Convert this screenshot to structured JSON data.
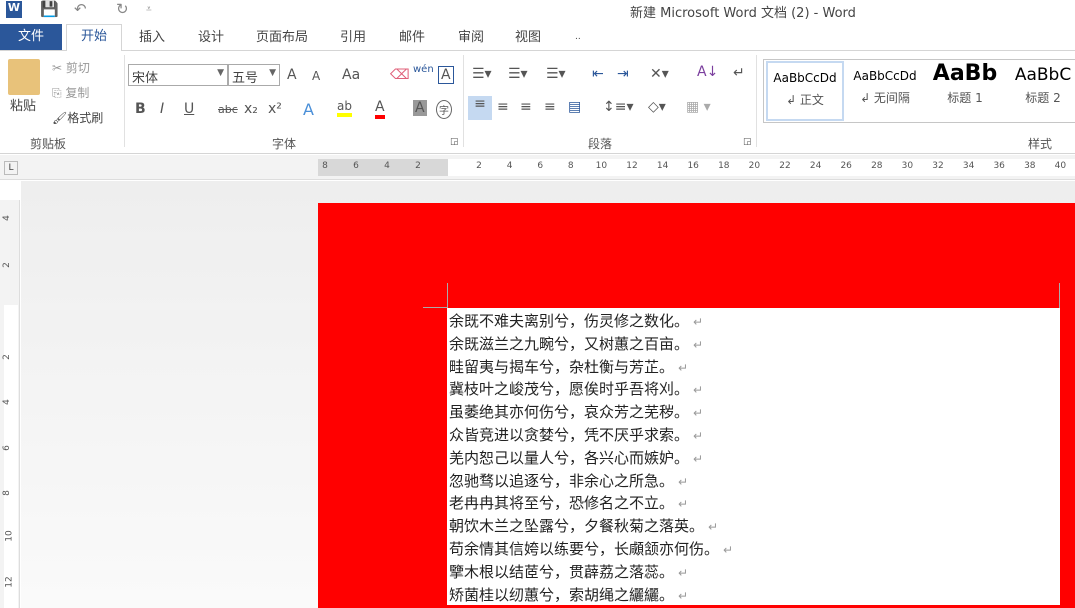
{
  "title": "新建 Microsoft Word 文档 (2) - Word",
  "quick_access": {
    "word": "W",
    "save": "💾",
    "undo": "↶",
    "redo": "↻",
    "customize": "⩡"
  },
  "tabs": {
    "file": "文件",
    "items": [
      "开始",
      "插入",
      "设计",
      "页面布局",
      "引用",
      "邮件",
      "审阅",
      "视图"
    ],
    "more": ".."
  },
  "clipboard": {
    "paste": "粘贴",
    "cut": "剪切",
    "copy": "复制",
    "format_painter": "格式刷",
    "group": "剪贴板"
  },
  "font": {
    "name": "宋体",
    "size": "五号",
    "grow": "A",
    "shrink": "A",
    "case": "Aa",
    "phonetic": "wén",
    "bold": "B",
    "italic": "I",
    "underline": "U",
    "strike": "abc",
    "sub": "x₂",
    "sup": "x²",
    "text_effect": "A",
    "highlight": "ab",
    "font_color": "A",
    "shading": "A",
    "enclose": "字",
    "group": "字体"
  },
  "paragraph": {
    "group": "段落"
  },
  "styles": {
    "group": "样式",
    "items": [
      {
        "preview": "AaBbCcDd",
        "name": "↲ 正文"
      },
      {
        "preview": "AaBbCcDd",
        "name": "↲ 无间隔"
      },
      {
        "preview": "AaBb",
        "name": "标题 1"
      },
      {
        "preview": "AaBbC",
        "name": "标题 2"
      }
    ]
  },
  "ruler": {
    "left": [
      "8",
      "6",
      "4",
      "2"
    ],
    "right": [
      "2",
      "4",
      "6",
      "8",
      "10",
      "12",
      "14",
      "16",
      "18",
      "20",
      "22",
      "24",
      "26",
      "28",
      "30",
      "32",
      "34",
      "36",
      "38",
      "40"
    ],
    "vertical": [
      "4",
      "2",
      "2",
      "4",
      "6",
      "8",
      "10",
      "12"
    ]
  },
  "document": {
    "lines": [
      "余既不难夫离别兮，伤灵修之数化。",
      "余既滋兰之九畹兮，又树蕙之百亩。",
      "畦留夷与揭车兮，杂杜衡与芳芷。",
      "冀枝叶之峻茂兮，愿俟时乎吾将刈。",
      "虽萎绝其亦何伤兮，哀众芳之芜秽。",
      "众皆竞进以贪婪兮，凭不厌乎求索。",
      "羌内恕己以量人兮，各兴心而嫉妒。",
      "忽驰骛以追逐兮，非余心之所急。",
      "老冉冉其将至兮，恐修名之不立。",
      "朝饮木兰之坠露兮，夕餐秋菊之落英。",
      "苟余情其信姱以练要兮，长顑颔亦何伤。",
      "擥木根以结茝兮，贯薜荔之落蕊。",
      "矫菌桂以纫蕙兮，索胡绳之纚纚。"
    ],
    "paragraph_mark": "↵"
  },
  "colors": {
    "file_tab": "#2b579a",
    "page": "#ff0000",
    "highlight": "#ffff00",
    "font_color": "#ff0000"
  }
}
